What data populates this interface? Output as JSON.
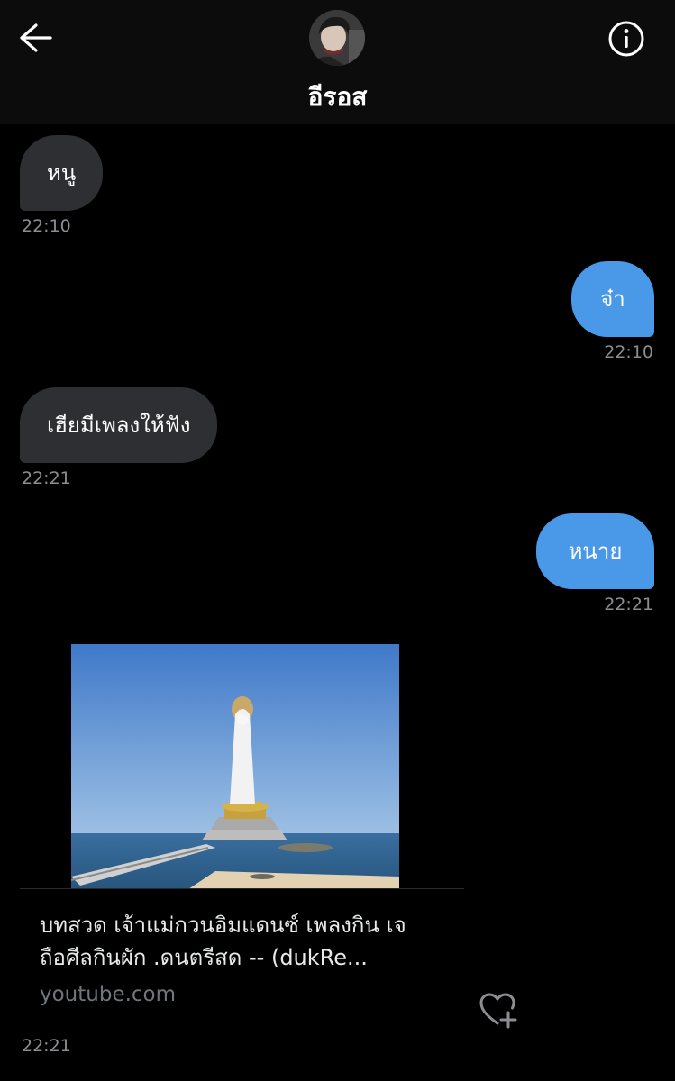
{
  "header": {
    "title": "อีรอส",
    "back_icon": "arrow-left-icon",
    "info_icon": "info-circle-icon"
  },
  "messages": [
    {
      "direction": "in",
      "text": "หนู",
      "time": "22:10"
    },
    {
      "direction": "out",
      "text": "จ๋า",
      "time": "22:10"
    },
    {
      "direction": "in",
      "text": "เฮียมีเพลงให้ฟัง",
      "time": "22:21"
    },
    {
      "direction": "out",
      "text": "หนาย",
      "time": "22:21"
    }
  ],
  "link_card": {
    "title": "บทสวด เจ้าแม่กวนอิมแดนซ์ เพลงกิน เจถือศีลกินผัก .ดนตรีสด -- (dukRe...",
    "domain": "youtube.com",
    "time": "22:21",
    "thumbnail_icon": "guanyin-statue-image"
  },
  "colors": {
    "outgoing_bubble": "#4a99e9",
    "incoming_bubble": "#2e2f33",
    "timestamp": "#8b8d91"
  },
  "react_icon": "heart-plus-icon"
}
